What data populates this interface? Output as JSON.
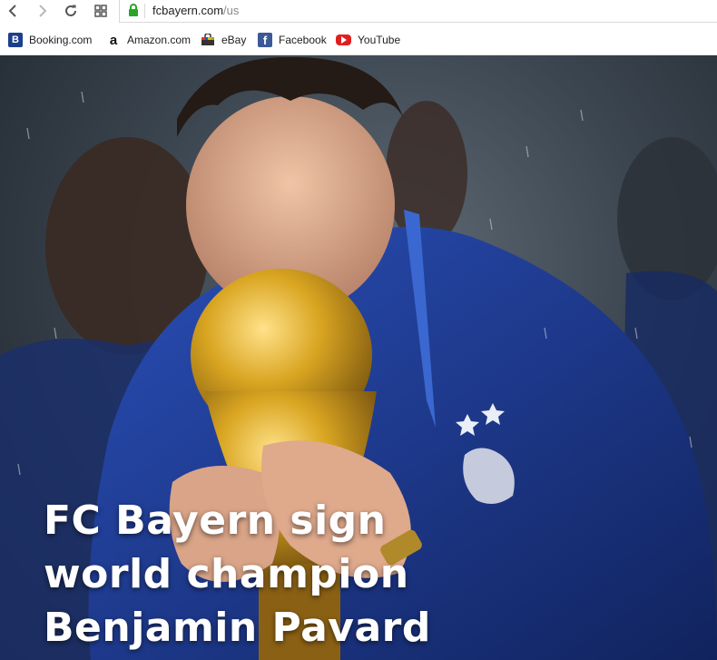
{
  "browser": {
    "url_domain": "fcbayern.com",
    "url_path": "/us",
    "nav_icons": [
      "back-icon",
      "forward-icon",
      "reload-icon",
      "apps-icon"
    ],
    "bookmarks": [
      {
        "label": "Booking.com",
        "icon": "booking-icon"
      },
      {
        "label": "Amazon.com",
        "icon": "amazon-icon"
      },
      {
        "label": "eBay",
        "icon": "ebay-icon"
      },
      {
        "label": "Facebook",
        "icon": "facebook-icon"
      },
      {
        "label": "YouTube",
        "icon": "youtube-icon"
      }
    ]
  },
  "hero": {
    "headline_lines": [
      "FC Bayern sign",
      "world champion",
      "Benjamin Pavard"
    ]
  },
  "colors": {
    "lock_green": "#2aa52a",
    "jersey_blue": "#1f3f9a",
    "trophy_gold": "#d9a521"
  }
}
